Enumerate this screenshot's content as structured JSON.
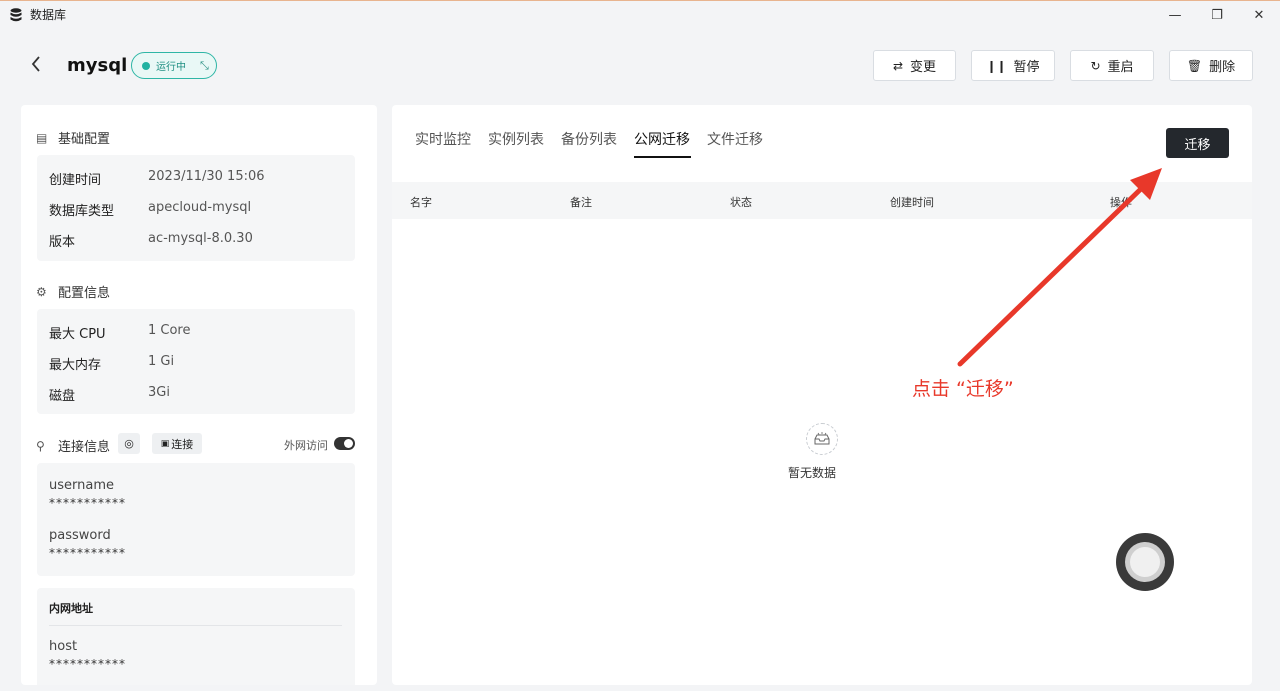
{
  "window": {
    "title": "数据库",
    "controls": [
      "—",
      "❐",
      "✕"
    ]
  },
  "header": {
    "instance_name": "mysql",
    "status_label": "运行中",
    "actions": [
      {
        "icon": "⇄",
        "label": "变更"
      },
      {
        "icon": "❙❙",
        "label": "暂停"
      },
      {
        "icon": "↻",
        "label": "重启"
      },
      {
        "icon": "🗑",
        "label": "删除"
      }
    ]
  },
  "basic_config": {
    "title": "基础配置",
    "rows": [
      {
        "k": "创建时间",
        "v": "2023/11/30 15:06"
      },
      {
        "k": "数据库类型",
        "v": "apecloud-mysql"
      },
      {
        "k": "版本",
        "v": "ac-mysql-8.0.30"
      }
    ]
  },
  "config_info": {
    "title": "配置信息",
    "rows": [
      {
        "k": "最大 CPU",
        "v": "1 Core"
      },
      {
        "k": "最大内存",
        "v": "1 Gi"
      },
      {
        "k": "磁盘",
        "v": "3Gi"
      }
    ]
  },
  "conn_info": {
    "title": "连接信息",
    "connect_label": "连接",
    "public_access_label": "外网访问",
    "public_access_on": true,
    "username_label": "username",
    "username_value": "***********",
    "password_label": "password",
    "password_value": "***********",
    "intranet_title": "内网地址",
    "host_label": "host",
    "host_value": "***********"
  },
  "tabs": [
    {
      "label": "实时监控"
    },
    {
      "label": "实例列表"
    },
    {
      "label": "备份列表"
    },
    {
      "label": "公网迁移"
    },
    {
      "label": "文件迁移"
    }
  ],
  "active_tab": 3,
  "migrate_button": "迁移",
  "table_headers": [
    "名字",
    "备注",
    "状态",
    "创建时间",
    "操作"
  ],
  "empty_text": "暂无数据",
  "annotation": "点击 “迁移”",
  "colors": {
    "accent_red": "#e8382a",
    "status_teal": "#21b2a1",
    "dark_button": "#24282d"
  }
}
